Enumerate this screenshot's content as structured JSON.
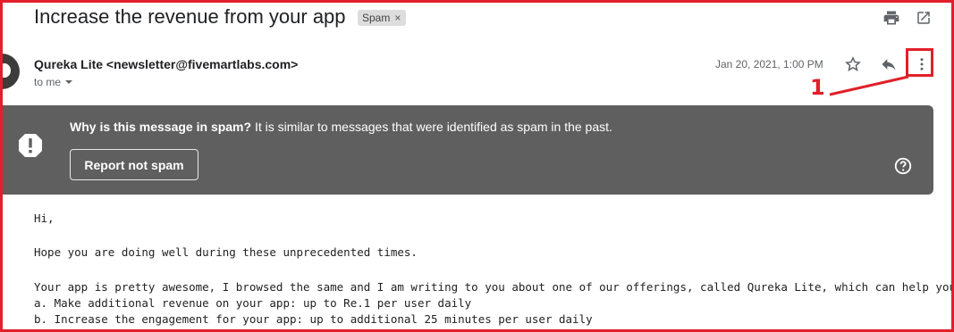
{
  "subject": "Increase the revenue from your app",
  "label_chip": {
    "text": "Spam",
    "remove": "×"
  },
  "toolbar": {
    "print_icon": "printer-icon",
    "popout_icon": "open-in-new-window-icon"
  },
  "message": {
    "sender": "Qureka Lite <newsletter@fivemartlabs.com>",
    "recipient": "to me",
    "date": "Jan 20, 2021, 1:00 PM"
  },
  "annotation": {
    "number": "1",
    "color": "#e0202a"
  },
  "spam_banner": {
    "question": "Why is this message in spam?",
    "reason": " It is similar to messages that were identified as spam in the past.",
    "button": "Report not spam",
    "background": "#5f5f5f"
  },
  "body": {
    "lines": [
      "Hi,",
      "Hope you are doing well during these unprecedented times.",
      "Your app is pretty awesome, I browsed the same and I am writing to you about one of our offerings, called Qureka Lite, which can help you:",
      "a. Make additional revenue on your app: up to Re.1 per user daily",
      "b. Increase the engagement for your app: up to additional 25 minutes per user daily"
    ]
  }
}
